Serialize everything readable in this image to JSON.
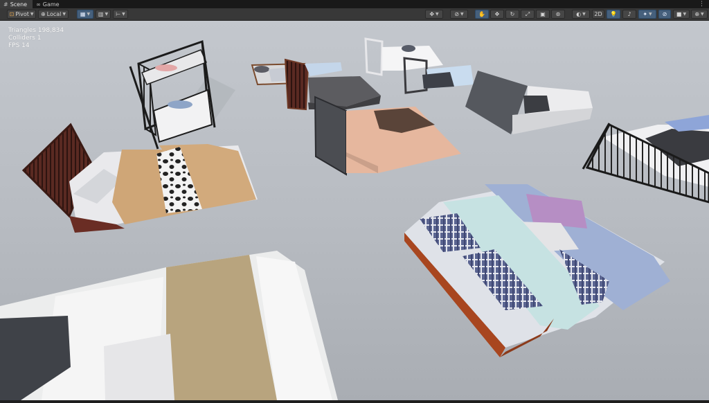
{
  "tabs": [
    {
      "label": "Scene",
      "icon": "grid-icon"
    },
    {
      "label": "Game",
      "icon": "gamepad-icon"
    }
  ],
  "tab_menu_icon": "more-icon",
  "toolbar": {
    "pivot_label": "Pivot",
    "local_label": "Local",
    "mode_2d_label": "2D"
  },
  "stats": {
    "triangles": "Triangles 198,834",
    "colliders": "Colliders 1",
    "fps": "FPS 14"
  }
}
